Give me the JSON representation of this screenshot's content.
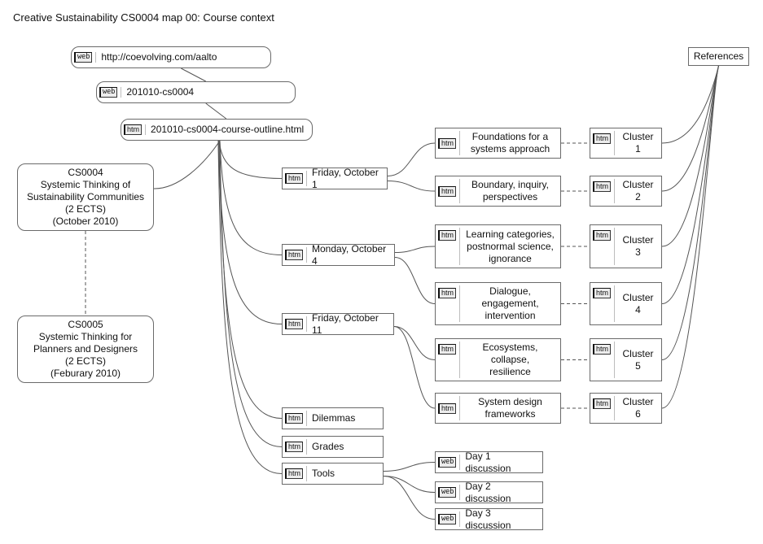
{
  "title": "Creative Sustainability CS0004 map 00: Course context",
  "nodes": {
    "url": {
      "badge": "web",
      "label": "http://coevolving.com/aalto"
    },
    "cs0004_folder": {
      "badge": "web",
      "label": "201010-cs0004"
    },
    "outline": {
      "badge": "htm",
      "label": "201010-cs0004-course-outline.html"
    },
    "course_cs0004": {
      "label": "CS0004\nSystemic Thinking of\nSustainability Communities\n(2 ECTS)\n(October 2010)"
    },
    "course_cs0005": {
      "label": "CS0005\nSystemic Thinking for\nPlanners and Designers\n(2 ECTS)\n(Feburary 2010)"
    },
    "fri_oct1": {
      "badge": "htm",
      "label": "Friday, October 1"
    },
    "mon_oct4": {
      "badge": "htm",
      "label": "Monday, October 4"
    },
    "fri_oct11": {
      "badge": "htm",
      "label": "Friday, October 11"
    },
    "dilemmas": {
      "badge": "htm",
      "label": "Dilemmas"
    },
    "grades": {
      "badge": "htm",
      "label": "Grades"
    },
    "tools": {
      "badge": "htm",
      "label": "Tools"
    },
    "foundations": {
      "badge": "htm",
      "label": "Foundations for a\nsystems approach"
    },
    "boundary": {
      "badge": "htm",
      "label": "Boundary, inquiry,\nperspectives"
    },
    "learning": {
      "badge": "htm",
      "label": "Learning categories,\npostnormal science,\nignorance"
    },
    "dialogue": {
      "badge": "htm",
      "label": "Dialogue,\nengagement,\nintervention"
    },
    "ecosystems": {
      "badge": "htm",
      "label": "Ecosystems,\ncollapse,\nresilience"
    },
    "sysdesign": {
      "badge": "htm",
      "label": "System design\nframeworks"
    },
    "cluster1": {
      "badge": "htm",
      "label": "Cluster 1"
    },
    "cluster2": {
      "badge": "htm",
      "label": "Cluster 2"
    },
    "cluster3": {
      "badge": "htm",
      "label": "Cluster 3"
    },
    "cluster4": {
      "badge": "htm",
      "label": "Cluster 4"
    },
    "cluster5": {
      "badge": "htm",
      "label": "Cluster 5"
    },
    "cluster6": {
      "badge": "htm",
      "label": "Cluster 6"
    },
    "day1": {
      "badge": "web",
      "label": "Day 1 discussion"
    },
    "day2": {
      "badge": "web",
      "label": "Day 2 discussion"
    },
    "day3": {
      "badge": "web",
      "label": "Day 3 discussion"
    },
    "references": {
      "label": "References"
    }
  },
  "edges": [
    {
      "from": "url",
      "to": "cs0004_folder",
      "style": "solid"
    },
    {
      "from": "cs0004_folder",
      "to": "outline",
      "style": "solid"
    },
    {
      "from": "outline",
      "to": "course_cs0004",
      "style": "solid"
    },
    {
      "from": "course_cs0004",
      "to": "course_cs0005",
      "style": "dashed"
    },
    {
      "from": "outline",
      "to": "fri_oct1",
      "style": "solid"
    },
    {
      "from": "outline",
      "to": "mon_oct4",
      "style": "solid"
    },
    {
      "from": "outline",
      "to": "fri_oct11",
      "style": "solid"
    },
    {
      "from": "outline",
      "to": "dilemmas",
      "style": "solid"
    },
    {
      "from": "outline",
      "to": "grades",
      "style": "solid"
    },
    {
      "from": "outline",
      "to": "tools",
      "style": "solid"
    },
    {
      "from": "fri_oct1",
      "to": "foundations",
      "style": "solid"
    },
    {
      "from": "fri_oct1",
      "to": "boundary",
      "style": "solid"
    },
    {
      "from": "mon_oct4",
      "to": "learning",
      "style": "solid"
    },
    {
      "from": "mon_oct4",
      "to": "dialogue",
      "style": "solid"
    },
    {
      "from": "fri_oct11",
      "to": "ecosystems",
      "style": "solid"
    },
    {
      "from": "fri_oct11",
      "to": "sysdesign",
      "style": "solid"
    },
    {
      "from": "foundations",
      "to": "cluster1",
      "style": "dashed"
    },
    {
      "from": "boundary",
      "to": "cluster2",
      "style": "dashed"
    },
    {
      "from": "learning",
      "to": "cluster3",
      "style": "dashed"
    },
    {
      "from": "dialogue",
      "to": "cluster4",
      "style": "dashed"
    },
    {
      "from": "ecosystems",
      "to": "cluster5",
      "style": "dashed"
    },
    {
      "from": "sysdesign",
      "to": "cluster6",
      "style": "dashed"
    },
    {
      "from": "cluster1",
      "to": "references",
      "style": "solid"
    },
    {
      "from": "cluster2",
      "to": "references",
      "style": "solid"
    },
    {
      "from": "cluster3",
      "to": "references",
      "style": "solid"
    },
    {
      "from": "cluster4",
      "to": "references",
      "style": "solid"
    },
    {
      "from": "cluster5",
      "to": "references",
      "style": "solid"
    },
    {
      "from": "cluster6",
      "to": "references",
      "style": "solid"
    },
    {
      "from": "tools",
      "to": "day1",
      "style": "solid"
    },
    {
      "from": "tools",
      "to": "day2",
      "style": "solid"
    },
    {
      "from": "tools",
      "to": "day3",
      "style": "solid"
    }
  ]
}
